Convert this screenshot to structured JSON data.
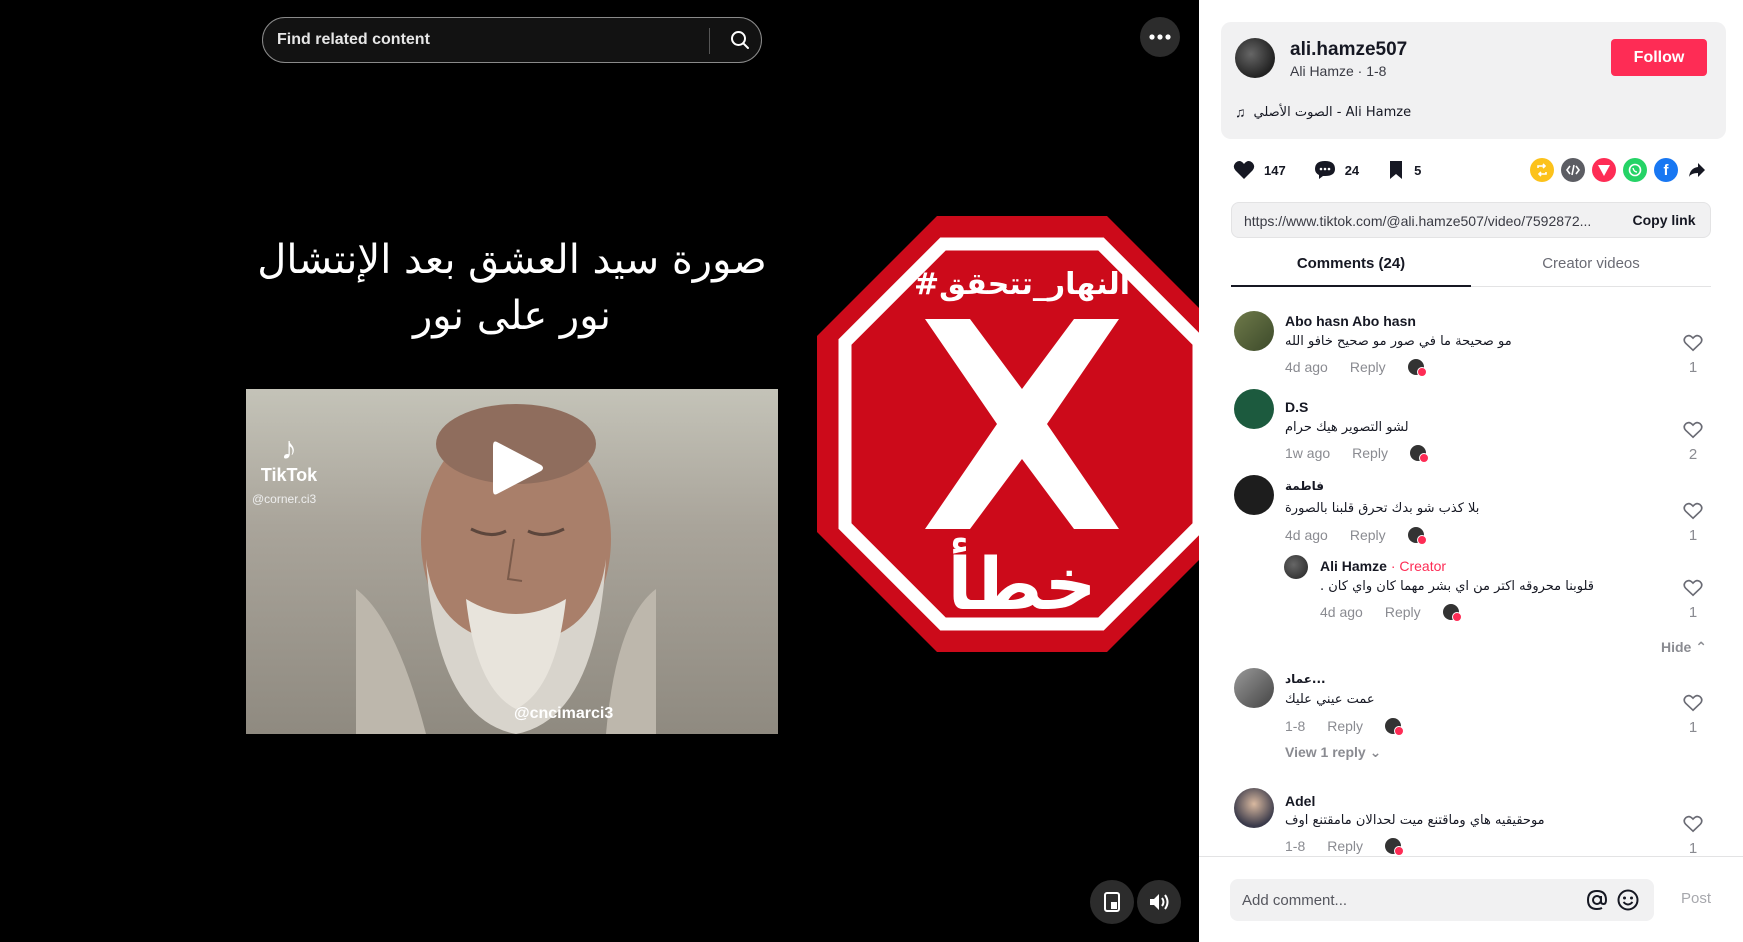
{
  "search": {
    "placeholder": "Find related content"
  },
  "video": {
    "caption_line1": "صورة سيد العشق بعد الإنتشال",
    "caption_line2": "نور على نور",
    "tiktok_logo": "TikTok",
    "tiktok_handle": "@corner.ci3",
    "tiktok_watermark": "@cncimarci3"
  },
  "fact_check": {
    "hashtag": "#النهار_تتحقق",
    "verdict": "خطأ",
    "color": "#d0021b"
  },
  "author": {
    "username": "ali.hamze507",
    "display_line": "Ali Hamze · 1-8",
    "follow_label": "Follow",
    "music": "الصوت الأصلي - Ali Hamze"
  },
  "stats": {
    "likes": "147",
    "comments": "24",
    "saves": "5"
  },
  "share": {
    "icons": [
      "repost-icon",
      "embed-icon",
      "send-icon",
      "whatsapp-icon",
      "facebook-icon",
      "share-arrow-icon"
    ]
  },
  "link": {
    "url": "https://www.tiktok.com/@ali.hamze507/video/7592872...",
    "copy_label": "Copy link"
  },
  "tabs": {
    "comments": "Comments (24)",
    "creator": "Creator videos"
  },
  "comments": [
    {
      "name": "Abo hasn Abo hasn",
      "text": "مو صحيحة ما في صور مو صحيح خافو الله",
      "time": "4d ago",
      "reply": "Reply",
      "likes": "1"
    },
    {
      "name": "D.S",
      "text": "لشو التصوير هيك حرام",
      "time": "1w ago",
      "reply": "Reply",
      "likes": "2"
    },
    {
      "name": "فاطمة",
      "text": "بلا كذب شو بدك تحرق قلبنا بالصورة",
      "time": "4d ago",
      "reply": "Reply",
      "likes": "1"
    },
    {
      "name": "Ali Hamze",
      "creator_tag": "· Creator",
      "text": "قلوبنا محروقه اكتر من اي بشر مهما كان واي كان .",
      "time": "4d ago",
      "reply": "Reply",
      "likes": "1"
    },
    {
      "name": "عماد...",
      "text": "عمت عيني عليك",
      "time": "1-8",
      "reply": "Reply",
      "likes": "1"
    },
    {
      "name": "Adel",
      "text": "موحقيقيه هاي وماقتنع ميت لحدالان مامقتنع اوف",
      "time": "1-8",
      "reply": "Reply",
      "likes": "1"
    }
  ],
  "hide_label": "Hide",
  "view_reply_label": "View 1 reply",
  "comment_bar": {
    "placeholder": "Add comment...",
    "post_label": "Post"
  }
}
